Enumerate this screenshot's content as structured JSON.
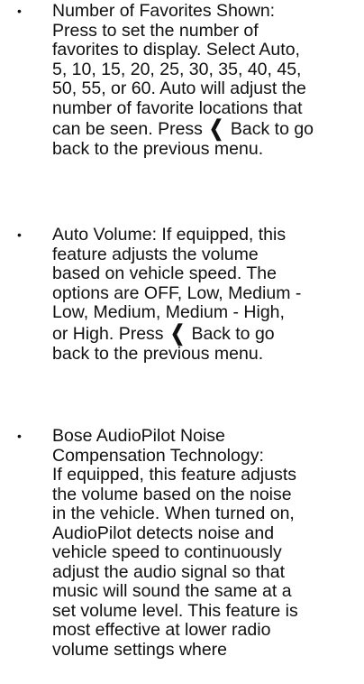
{
  "items": [
    {
      "lines": [
        "Number of Favorites Shown:",
        "Press to set the number of",
        "favorites to display. Select Auto,",
        "5, 10, 15, 20, 25, 30, 35, 40, 45,",
        "50, 55, or 60. Auto will adjust the",
        "number of favorite locations that",
        "can be seen. Press",
        "Back to go",
        "back to the previous menu."
      ]
    },
    {
      "lines": [
        "Auto Volume: If equipped, this",
        "feature adjusts the volume",
        "based on vehicle speed. The",
        "options are OFF, Low, Medium -",
        "Low, Medium, Medium - High,",
        "or High. Press",
        "Back to go",
        "back to the previous menu."
      ]
    },
    {
      "lines": [
        "Bose AudioPilot Noise",
        "Compensation Technology:",
        "If equipped, this feature adjusts",
        "the volume based on the noise",
        "in the vehicle. When turned on,",
        "AudioPilot detects noise and",
        "vehicle speed to continuously",
        "adjust the audio signal so that",
        "music will sound the same at a",
        "set volume level. This feature is",
        "most effective at lower radio",
        "volume settings where"
      ]
    }
  ],
  "bullet_char": "•",
  "back_icon_glyph": "❮"
}
